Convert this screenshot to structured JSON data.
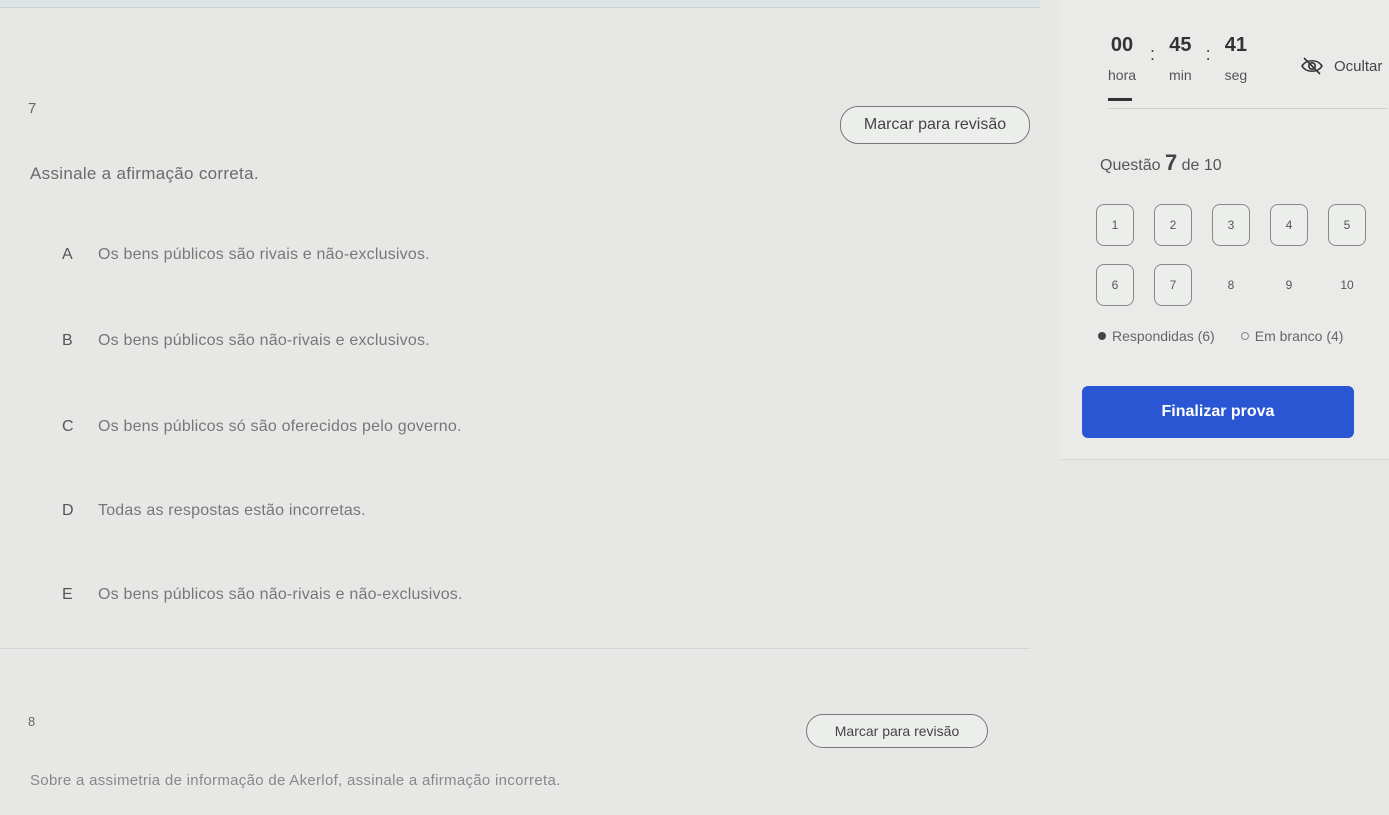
{
  "timer": {
    "hours": "00",
    "minutes": "45",
    "seconds": "41",
    "hours_label": "hora",
    "minutes_label": "min",
    "seconds_label": "seg",
    "separator": ":",
    "hide_label": "Ocultar"
  },
  "question_current": {
    "number": "7",
    "mark_label": "Marcar para revisão",
    "prompt": "Assinale a afirmação correta.",
    "options": [
      {
        "letter": "A",
        "text": "Os bens públicos são rivais e não-exclusivos."
      },
      {
        "letter": "B",
        "text": "Os bens públicos são não-rivais e exclusivos."
      },
      {
        "letter": "C",
        "text": "Os bens públicos só são oferecidos pelo governo."
      },
      {
        "letter": "D",
        "text": "Todas as respostas estão incorretas."
      },
      {
        "letter": "E",
        "text": "Os bens públicos são não-rivais e não-exclusivos."
      }
    ]
  },
  "question_next": {
    "number": "8",
    "mark_label": "Marcar para revisão",
    "prompt": "Sobre a assimetria de informação de Akerlof, assinale a afirmação incorreta."
  },
  "navigator": {
    "title_prefix": "Questão",
    "current": "7",
    "title_suffix": "de 10",
    "questions": [
      {
        "n": "1",
        "boxed": true
      },
      {
        "n": "2",
        "boxed": true
      },
      {
        "n": "3",
        "boxed": true
      },
      {
        "n": "4",
        "boxed": true
      },
      {
        "n": "5",
        "boxed": true
      },
      {
        "n": "6",
        "boxed": true
      },
      {
        "n": "7",
        "boxed": true
      },
      {
        "n": "8",
        "boxed": false
      },
      {
        "n": "9",
        "boxed": false
      },
      {
        "n": "10",
        "boxed": false
      }
    ],
    "answered_label": "Respondidas (6)",
    "blank_label": "Em branco (4)"
  },
  "finish_label": "Finalizar prova",
  "colors": {
    "accent": "#2a56d4"
  }
}
